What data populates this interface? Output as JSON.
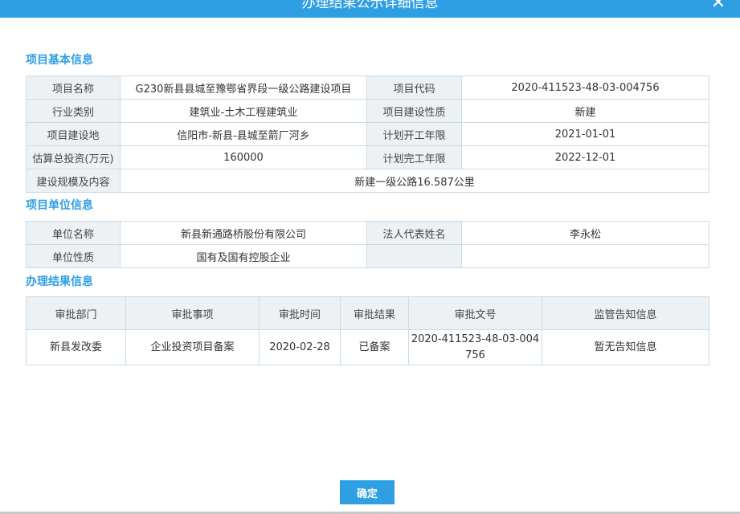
{
  "dialog": {
    "title": "办理结果公示详细信息",
    "close_label": "✕",
    "confirm_label": "确定"
  },
  "basic": {
    "title": "项目基本信息",
    "rows": [
      [
        "项目名称",
        "G230新县县城至豫鄂省界段一级公路建设项目",
        "项目代码",
        "2020-411523-48-03-004756"
      ],
      [
        "行业类别",
        "建筑业-土木工程建筑业",
        "项目建设性质",
        "新建"
      ],
      [
        "项目建设地",
        "信阳市-新县-县城至箭厂河乡",
        "计划开工年限",
        "2021-01-01"
      ],
      [
        "估算总投资(万元)",
        "160000",
        "计划完工年限",
        "2022-12-01"
      ]
    ],
    "scale_label": "建设规模及内容",
    "scale_value": "新建一级公路16.587公里"
  },
  "unit": {
    "title": "项目单位信息",
    "rows": [
      [
        "单位名称",
        "新县新通路桥股份有限公司",
        "法人代表姓名",
        "李永松"
      ],
      [
        "单位性质",
        "国有及国有控股企业",
        "",
        ""
      ]
    ]
  },
  "result": {
    "title": "办理结果信息",
    "headers": [
      "审批部门",
      "审批事项",
      "审批时间",
      "审批结果",
      "审批文号",
      "监管告知信息"
    ],
    "rows": [
      [
        "新县发改委",
        "企业投资项目备案",
        "2020-02-28",
        "已备案",
        "2020-411523-48-03-004756",
        "暂无告知信息"
      ]
    ]
  }
}
